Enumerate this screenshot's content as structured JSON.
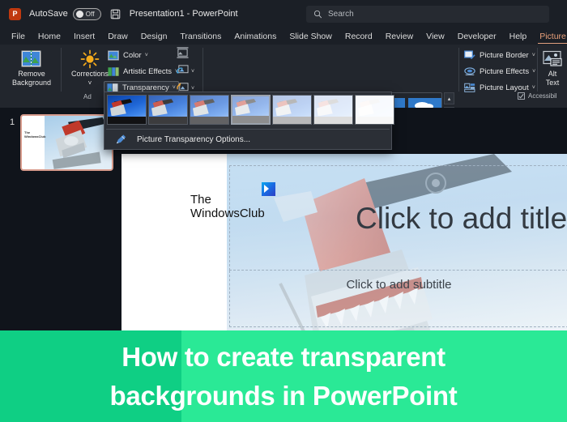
{
  "titlebar": {
    "app_icon": "powerpoint-logo",
    "app_letter": "P",
    "autosave_label": "AutoSave",
    "autosave_state": "Off",
    "save_icon": "save-icon",
    "document_title": "Presentation1  -  PowerPoint"
  },
  "search": {
    "icon": "search-icon",
    "placeholder": "Search",
    "value": "Search"
  },
  "tabs": [
    {
      "label": "File",
      "active": false
    },
    {
      "label": "Home",
      "active": false
    },
    {
      "label": "Insert",
      "active": false
    },
    {
      "label": "Draw",
      "active": false
    },
    {
      "label": "Design",
      "active": false
    },
    {
      "label": "Transitions",
      "active": false
    },
    {
      "label": "Animations",
      "active": false
    },
    {
      "label": "Slide Show",
      "active": false
    },
    {
      "label": "Record",
      "active": false
    },
    {
      "label": "Review",
      "active": false
    },
    {
      "label": "View",
      "active": false
    },
    {
      "label": "Developer",
      "active": false
    },
    {
      "label": "Help",
      "active": false
    },
    {
      "label": "Picture Format",
      "active": true
    }
  ],
  "ribbon": {
    "groups": {
      "adjust_label": "Ad",
      "accessibility_label": "Accessibil"
    },
    "remove_background": {
      "line1": "Remove",
      "line2": "Background",
      "icon": "remove-background-icon"
    },
    "corrections": {
      "label": "Corrections",
      "icon": "corrections-sun-icon",
      "caret": "˅"
    },
    "color": {
      "label": "Color",
      "icon": "color-picture-icon",
      "caret": "˅"
    },
    "artistic_effects": {
      "label": "Artistic Effects",
      "icon": "artistic-effects-icon",
      "caret": "˅"
    },
    "transparency": {
      "label": "Transparency",
      "icon": "transparency-icon",
      "caret": "˅",
      "active": true
    },
    "compress_pictures": {
      "icon": "compress-pictures-icon"
    },
    "change_picture": {
      "icon": "change-picture-icon",
      "caret": "˅"
    },
    "reset_picture": {
      "icon": "reset-picture-icon",
      "caret": "˅"
    },
    "picture_border": {
      "label": "Picture Border",
      "icon": "picture-border-icon",
      "caret": "˅"
    },
    "picture_effects": {
      "label": "Picture Effects",
      "icon": "picture-effects-icon",
      "caret": "˅"
    },
    "picture_layout": {
      "label": "Picture Layout",
      "icon": "picture-layout-icon",
      "caret": "˅"
    },
    "alt_text": {
      "line1": "Alt",
      "line2": "Text",
      "icon": "alt-text-icon"
    },
    "accessibility_icon": "accessibility-checker-icon",
    "gallery_scroll": {
      "up": "▴",
      "down": "▾",
      "more": "≡"
    },
    "picture_styles": [
      {
        "name": "simple-frame-white",
        "style": "framed"
      },
      {
        "name": "beveled-matte-white",
        "style": "framed"
      },
      {
        "name": "metal-frame",
        "style": "framed2"
      },
      {
        "name": "drop-shadow-rectangle",
        "style": "plain"
      },
      {
        "name": "reflected-rounded-rectangle",
        "style": "plain"
      },
      {
        "name": "soft-edge-rectangle",
        "style": "plain"
      }
    ]
  },
  "transparency_dropdown": {
    "open": true,
    "thumbnails": [
      {
        "label": "Transparency: 0%",
        "veil": 0.0,
        "selected": false
      },
      {
        "label": "Transparency: 15%",
        "veil": 0.18,
        "selected": false
      },
      {
        "label": "Transparency: 30%",
        "veil": 0.34,
        "selected": false
      },
      {
        "label": "Transparency: 50%",
        "veil": 0.52,
        "selected": true
      },
      {
        "label": "Transparency: 65%",
        "veil": 0.7,
        "selected": false
      },
      {
        "label": "Transparency: 80%",
        "veil": 0.86,
        "selected": false
      },
      {
        "label": "Transparency: 95%",
        "veil": 0.97,
        "selected": false
      }
    ],
    "options_label": "Picture Transparency Options...",
    "options_icon": "transparency-options-icon"
  },
  "slide_panel": {
    "slide_number": "1",
    "thumbnail_name": "slide-1-thumbnail",
    "watermark": "The\nWindowsClub"
  },
  "slide": {
    "watermark_line1": "The",
    "watermark_line2": "WindowsClub",
    "watermark_logo": "windowsclub-logo",
    "title_placeholder": "Click to add title",
    "subtitle_placeholder": "Click to add subtitle",
    "picture_name": "airplane-shark-nose-art-picture"
  },
  "banner": {
    "line1": "How to create transparent",
    "line2": "backgrounds in PowerPoint",
    "color_left": "#0fcf84",
    "color_right": "#2ae996",
    "text_color": "#ffffff"
  }
}
